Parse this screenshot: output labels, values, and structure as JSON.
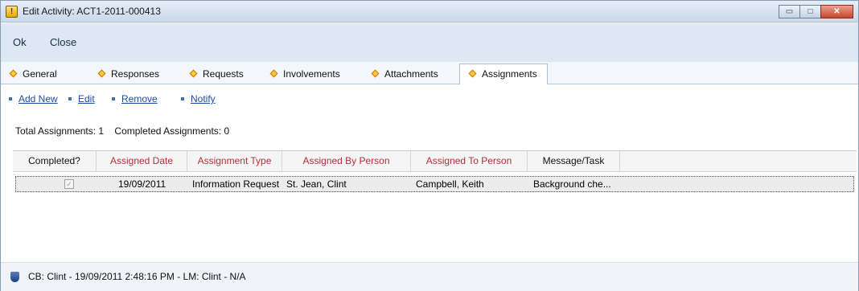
{
  "window": {
    "title": "Edit Activity: ACT1-2011-000413",
    "controls": {
      "minimize": "▭",
      "maximize": "□",
      "close": "✕"
    }
  },
  "menu": {
    "ok": "Ok",
    "close": "Close"
  },
  "tabs": [
    {
      "label": "General"
    },
    {
      "label": "Responses"
    },
    {
      "label": "Requests"
    },
    {
      "label": "Involvements"
    },
    {
      "label": "Attachments"
    },
    {
      "label": "Assignments",
      "active": true
    }
  ],
  "actions": {
    "add_new": "Add New",
    "edit": "Edit",
    "remove": "Remove",
    "notify": "Notify"
  },
  "summary": {
    "total": "Total Assignments: 1",
    "completed": "Completed Assignments: 0"
  },
  "grid": {
    "columns": [
      "Completed?",
      "Assigned Date",
      "Assignment Type",
      "Assigned By Person",
      "Assigned To Person",
      "Message/Task"
    ],
    "rows": [
      {
        "completed": "✓",
        "assigned_date": "19/09/2011",
        "assignment_type": "Information Request",
        "assigned_by": "St. Jean, Clint",
        "assigned_to": "Campbell, Keith",
        "message": "Background che..."
      }
    ]
  },
  "status": {
    "text": "CB: Clint - 19/09/2011 2:48:16 PM - LM: Clint - N/A"
  },
  "colors": {
    "header_red": "#b5303a",
    "link_blue": "#1a4f9e",
    "tab_diamond": "#ffc640"
  },
  "icons": {
    "title": "activity-warning-icon",
    "status": "shield-icon"
  }
}
